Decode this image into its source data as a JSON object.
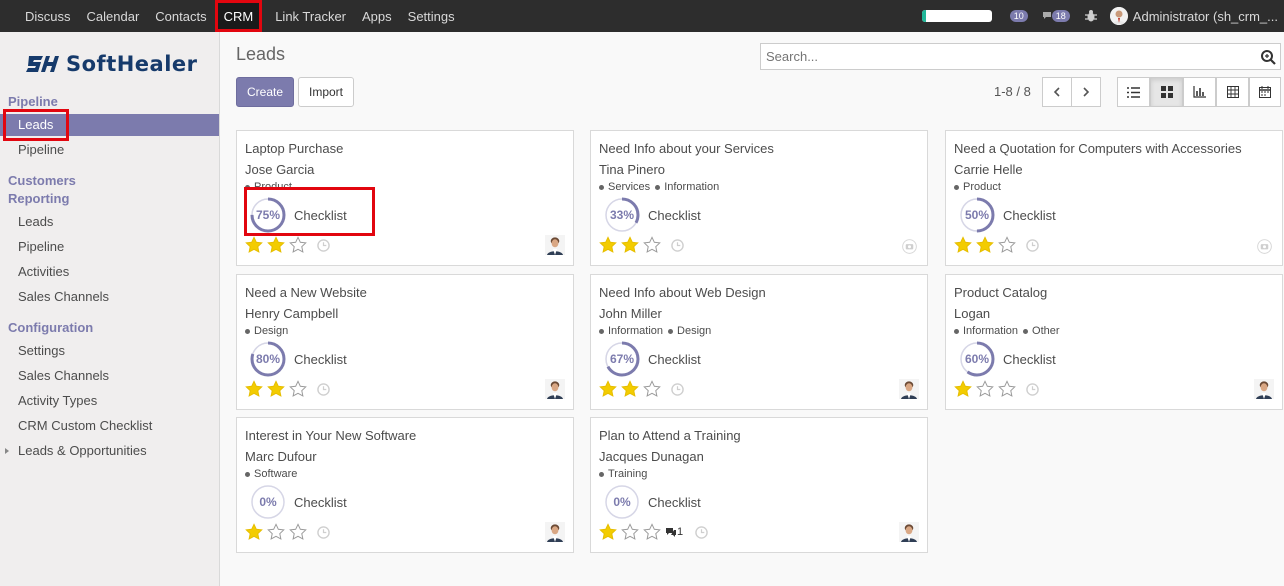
{
  "topbar": {
    "menu": [
      "Discuss",
      "Calendar",
      "Contacts",
      "CRM",
      "Link Tracker",
      "Apps",
      "Settings"
    ],
    "active": "CRM",
    "activity_count": "10",
    "message_count": "18",
    "user": "Administrator (sh_crm_..."
  },
  "sidebar": {
    "logo_text": "SoftHealer",
    "sections": {
      "pipeline": "Pipeline",
      "customers": "Customers",
      "reporting": "Reporting",
      "configuration": "Configuration"
    },
    "pipeline_items": [
      "Leads",
      "Pipeline"
    ],
    "reporting_items": [
      "Leads",
      "Pipeline",
      "Activities",
      "Sales Channels"
    ],
    "configuration_items": [
      "Settings",
      "Sales Channels",
      "Activity Types",
      "CRM Custom Checklist",
      "Leads & Opportunities"
    ]
  },
  "control": {
    "title": "Leads",
    "search_placeholder": "Search...",
    "create_label": "Create",
    "import_label": "Import",
    "pager": "1-8 / 8"
  },
  "cards": [
    {
      "title": "Laptop Purchase",
      "customer": "Jose Garcia",
      "tags": [
        "Product"
      ],
      "progress": 75,
      "progress_label": "75%",
      "checklist": "Checklist",
      "stars": 2,
      "messages": "",
      "assignee": "person"
    },
    {
      "title": "Need Info about your Services",
      "customer": "Tina Pinero",
      "tags": [
        "Services",
        "Information"
      ],
      "progress": 33,
      "progress_label": "33%",
      "checklist": "Checklist",
      "stars": 2,
      "messages": "",
      "assignee": "camera"
    },
    {
      "title": "Need a Quotation for Computers with Accessories",
      "customer": "Carrie Helle",
      "tags": [
        "Product"
      ],
      "progress": 50,
      "progress_label": "50%",
      "checklist": "Checklist",
      "stars": 2,
      "messages": "",
      "assignee": "camera"
    },
    {
      "title": "Need a New Website",
      "customer": "Henry Campbell",
      "tags": [
        "Design"
      ],
      "progress": 80,
      "progress_label": "80%",
      "checklist": "Checklist",
      "stars": 2,
      "messages": "",
      "assignee": "person"
    },
    {
      "title": "Need Info about Web Design",
      "customer": "John Miller",
      "tags": [
        "Information",
        "Design"
      ],
      "progress": 67,
      "progress_label": "67%",
      "checklist": "Checklist",
      "stars": 2,
      "messages": "",
      "assignee": "person"
    },
    {
      "title": "Product Catalog",
      "customer": "Logan",
      "tags": [
        "Information",
        "Other"
      ],
      "progress": 60,
      "progress_label": "60%",
      "checklist": "Checklist",
      "stars": 1,
      "messages": "",
      "assignee": "person"
    },
    {
      "title": "Interest in Your New Software",
      "customer": "Marc Dufour",
      "tags": [
        "Software"
      ],
      "progress": 0,
      "progress_label": "0%",
      "checklist": "Checklist",
      "stars": 1,
      "messages": "",
      "assignee": "person"
    },
    {
      "title": "Plan to Attend a Training",
      "customer": "Jacques Dunagan",
      "tags": [
        "Training"
      ],
      "progress": 0,
      "progress_label": "0%",
      "checklist": "Checklist",
      "stars": 1,
      "messages": "1",
      "assignee": "person"
    }
  ],
  "colors": {
    "accent": "#7c7bad",
    "highlight": "#e2060f",
    "star": "#f3cc00",
    "topbar": "#2d2d2d"
  },
  "icons": [
    "search-icon",
    "chevron-left-icon",
    "chevron-right-icon",
    "list-view-icon",
    "kanban-view-icon",
    "graph-view-icon",
    "pivot-view-icon",
    "calendar-view-icon",
    "star-icon",
    "clock-icon",
    "camera-icon",
    "bug-icon",
    "comments-icon"
  ]
}
